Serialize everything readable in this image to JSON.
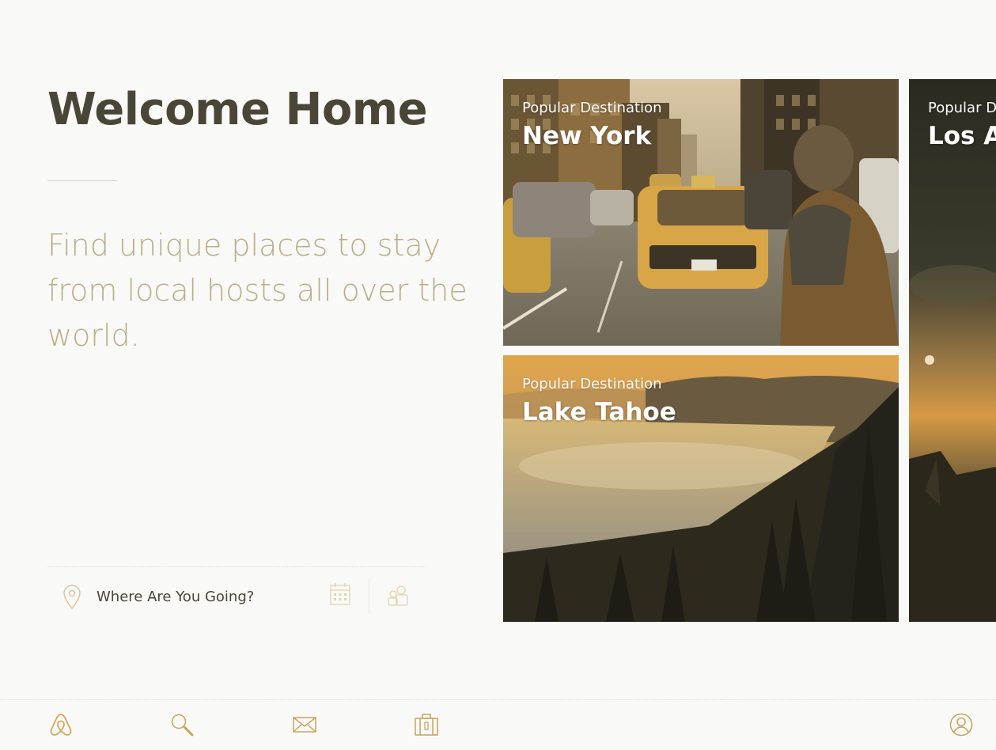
{
  "header": {
    "title": "Welcome Home",
    "subtitle": "Find unique places to stay from local hosts all over the world."
  },
  "search": {
    "placeholder": "Where Are You Going?",
    "icons": [
      "map-pin-icon",
      "calendar-icon",
      "guests-icon"
    ]
  },
  "destinations": [
    {
      "kicker": "Popular Destination",
      "name": "New York"
    },
    {
      "kicker": "Popular Destination",
      "name": "Lake Tahoe"
    },
    {
      "kicker": "Popular D",
      "name": "Los A"
    }
  ],
  "tabbar": {
    "items": [
      "airbnb-logo-icon",
      "search-icon",
      "messages-icon",
      "trips-icon",
      "profile-icon"
    ]
  },
  "colors": {
    "background": "#f9f9f8",
    "heading": "#4a4637",
    "subtitle": "#bbae87",
    "accent": "#d4a95a",
    "icon": "#c9a35c"
  }
}
